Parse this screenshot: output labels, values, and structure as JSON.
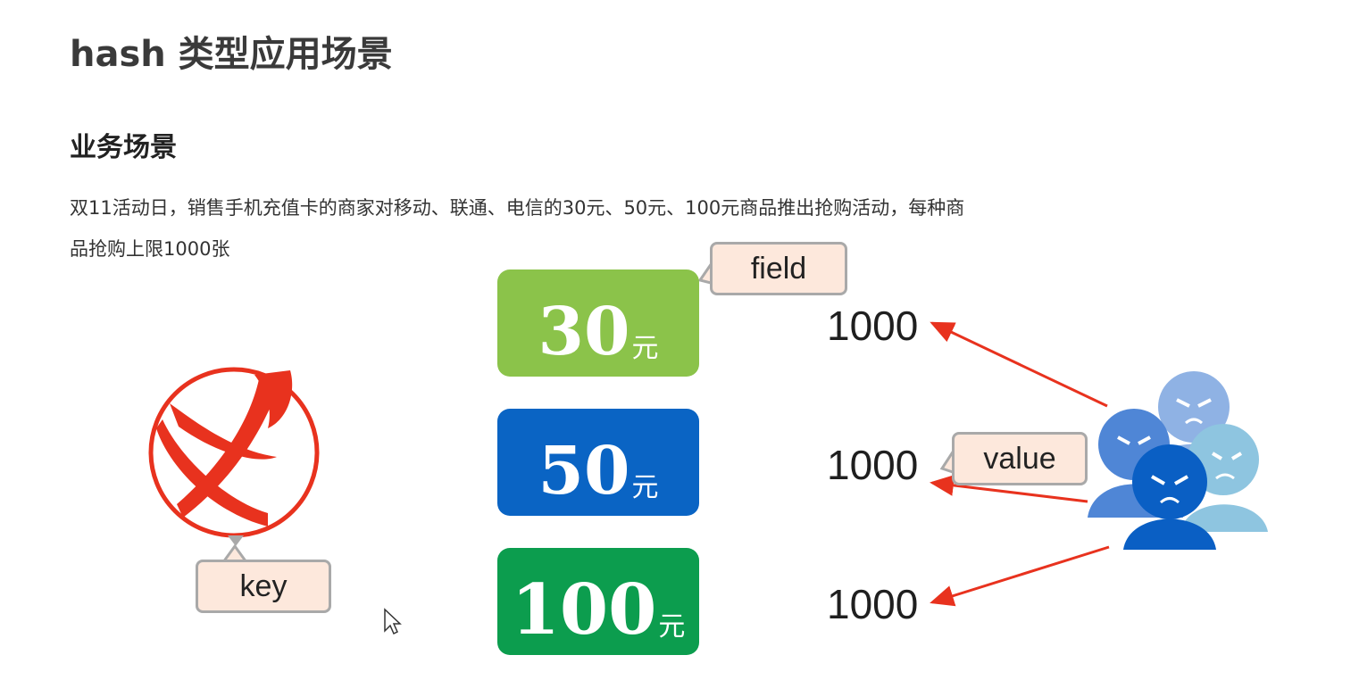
{
  "page": {
    "title": "hash 类型应用场景",
    "subtitle": "业务场景",
    "description_lines": [
      "双11活动日，销售手机充值卡的商家对移动、联通、电信的30元、50元、100元商品推出抢购活动，每种商",
      "品抢购上限1000张"
    ]
  },
  "diagram": {
    "cards": [
      {
        "amount": "30",
        "unit": "元",
        "color": "#8bc34a"
      },
      {
        "amount": "50",
        "unit": "元",
        "color": "#0a64c4"
      },
      {
        "amount": "100",
        "unit": "元",
        "color": "#0c9d4e"
      }
    ],
    "values": [
      "1000",
      "1000",
      "1000"
    ],
    "callouts": {
      "field": "field",
      "value": "value",
      "key": "key"
    },
    "logo_icon": "china-telecom-logo",
    "users_icon": "angry-users-group",
    "arrow_color": "#e8321e"
  }
}
